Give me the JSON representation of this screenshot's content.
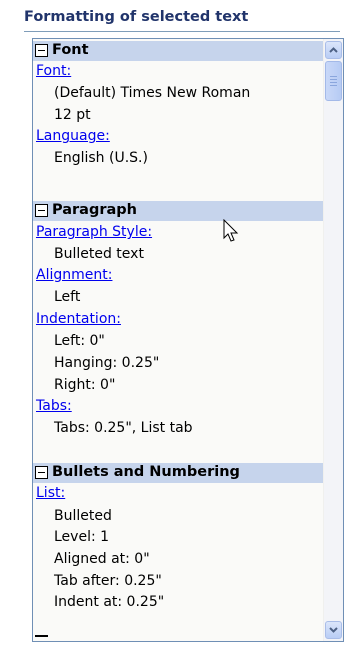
{
  "pane_title": "Formatting of selected text",
  "sections": {
    "font": {
      "title": "Font",
      "font_link": "Font:",
      "font_lines": [
        "(Default) Times New Roman",
        "12 pt"
      ],
      "language_link": "Language:",
      "language_lines": [
        "English (U.S.)"
      ]
    },
    "paragraph": {
      "title": "Paragraph",
      "style_link": "Paragraph Style:",
      "style_lines": [
        "Bulleted text"
      ],
      "alignment_link": "Alignment:",
      "alignment_lines": [
        "Left"
      ],
      "indentation_link": "Indentation:",
      "indentation_lines": [
        "Left:  0\"",
        "Hanging:  0.25\"",
        "Right:  0\""
      ],
      "tabs_link": "Tabs:",
      "tabs_lines": [
        "Tabs:  0.25\", List tab"
      ]
    },
    "bullets": {
      "title": "Bullets and Numbering",
      "list_link": "List:",
      "list_lines": [
        "Bulleted",
        "Level: 1",
        "Aligned at:  0\"",
        "Tab after:  0.25\"",
        "Indent at:  0.25\""
      ]
    }
  },
  "icons": {
    "collapse": "minus-box-icon",
    "scroll_up": "chevron-up-icon",
    "scroll_down": "chevron-down-icon",
    "pointer": "mouse-pointer-icon"
  },
  "colors": {
    "title": "#21346b",
    "section_header": "#c6d4ec",
    "link": "#0000ee",
    "border": "#6f8fb5"
  }
}
